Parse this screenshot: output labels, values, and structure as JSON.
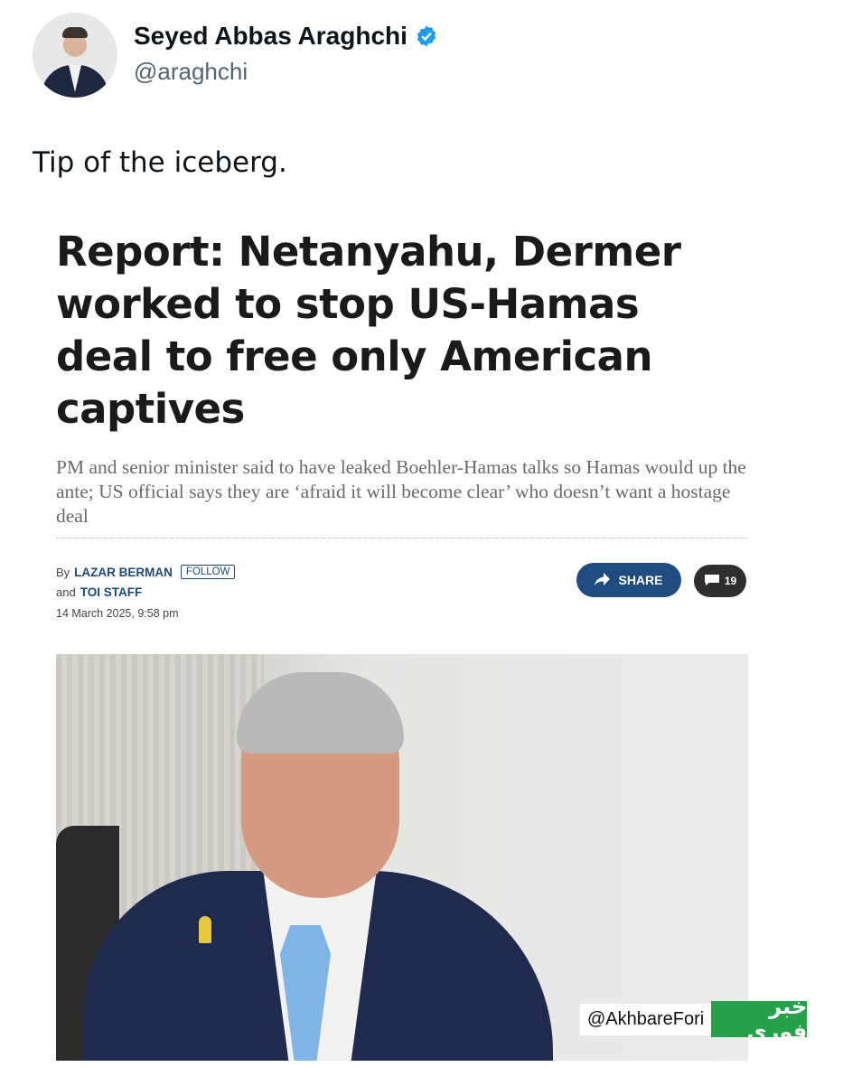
{
  "tweet": {
    "display_name": "Seyed Abbas Araghchi",
    "handle": "@araghchi",
    "verified": true,
    "text": "Tip of the iceberg."
  },
  "article": {
    "headline": "Report: Netanyahu, Dermer worked to stop US-Hamas deal to free only American captives",
    "subhead": "PM and senior minister said to have leaked Boehler-Hamas talks so Hamas would up the ante; US official says they are ‘afraid it will become clear’ who doesn’t want a hostage deal",
    "by_label": "By",
    "author": "LAZAR BERMAN",
    "follow_label": "FOLLOW",
    "and_label": "and",
    "coauthor": "TOI STAFF",
    "date": "14 March 2025, 9:58 pm",
    "share_label": "SHARE",
    "comment_count": "19"
  },
  "watermark": {
    "handle": "@AkhbareFori",
    "logo_text": "خبر فوری"
  },
  "colors": {
    "verified": "#1d9bf0",
    "share_button": "#1f4c80",
    "comments_button": "#2e2e2e",
    "logo": "#25a14a"
  }
}
